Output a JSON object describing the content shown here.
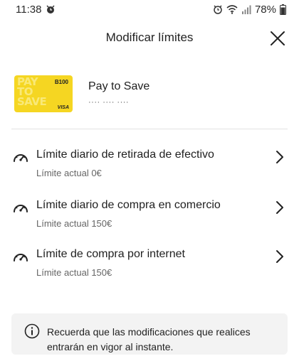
{
  "status_bar": {
    "time": "11:38",
    "battery": "78%",
    "icons": [
      "alarm-icon",
      "alarm-icon",
      "wifi-icon",
      "signal-icon",
      "battery-icon"
    ]
  },
  "header": {
    "title": "Modificar límites",
    "close_icon": "close-icon"
  },
  "card": {
    "name": "Pay to Save",
    "masked_number": "···· ···· ····",
    "thumb_text": "PAY TO SAVE",
    "thumb_brand": "B100",
    "thumb_network": "VISA",
    "thumb_color": "#f5d622"
  },
  "limits": [
    {
      "title": "Límite diario de retirada de efectivo",
      "current": "Límite actual 0€"
    },
    {
      "title": "Límite diario de compra en comercio",
      "current": "Límite actual 150€"
    },
    {
      "title": "Límite de compra por internet",
      "current": "Límite actual 150€"
    }
  ],
  "info": {
    "text": "Recuerda que las modificaciones que realices entrarán en vigor al instante."
  }
}
